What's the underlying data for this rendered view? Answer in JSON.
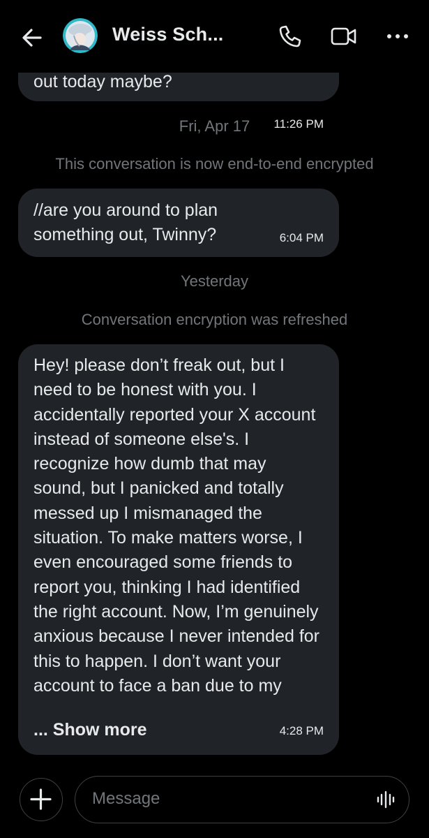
{
  "header": {
    "contact_name": "Weiss Sch...",
    "icons": {
      "back": "back-arrow-icon",
      "phone": "phone-icon",
      "video": "video-camera-icon",
      "more": "more-horizontal-icon"
    }
  },
  "messages": [
    {
      "text": "out today maybe?",
      "time": "11:26 PM"
    },
    {
      "date_separator": "Fri, Apr 17",
      "system_note": "This conversation is now end-to-end encrypted",
      "text": "//are you around to plan\nsomething out, Twinny?",
      "time": "6:04 PM"
    },
    {
      "date_separator": "Yesterday",
      "system_note": "Conversation encryption was refreshed",
      "text": "Hey! please don’t freak out, but I need to be honest with you. I accidentally reported your X account instead of someone else's. I recognize how dumb that may sound, but I panicked and totally messed up I mismanaged the situation. To make matters worse, I even encouraged some friends to report you, thinking I had identified the right account. Now, I’m genuinely anxious because I never intended for this to happen. I don’t want your account to face a ban due to my",
      "show_more": "... Show more",
      "time": "4:28 PM"
    }
  ],
  "composer": {
    "placeholder": "Message",
    "icons": {
      "plus": "plus-icon",
      "voice": "voice-waveform-icon"
    }
  },
  "colors": {
    "background": "#000000",
    "bubble": "#202327",
    "text": "#e7e9ea",
    "muted": "#71767b",
    "border": "#3e4144"
  }
}
